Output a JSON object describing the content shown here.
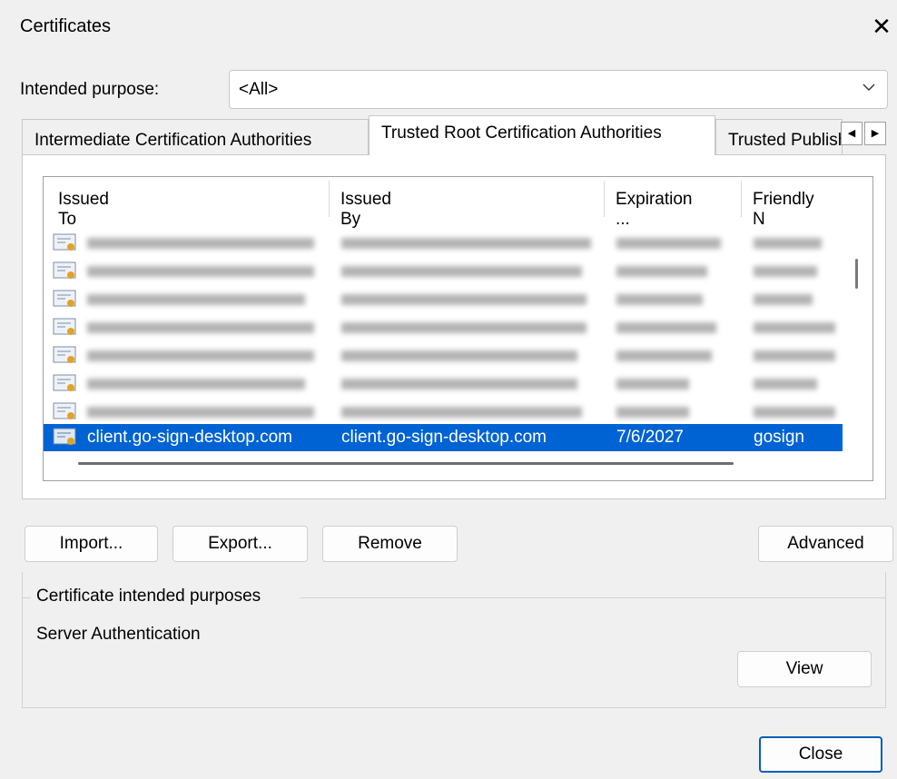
{
  "dialog": {
    "title": "Certificates",
    "close_glyph": "✕"
  },
  "intended_purpose": {
    "label": "Intended purpose:",
    "value": "<All>"
  },
  "tabs": [
    {
      "label": "Intermediate Certification Authorities",
      "active": false
    },
    {
      "label": "Trusted Root Certification Authorities",
      "active": true
    },
    {
      "label": "Trusted Publishers",
      "active": false
    }
  ],
  "tab_scroll": {
    "left": "◀",
    "right": "▶"
  },
  "list": {
    "columns": [
      "Issued To",
      "Issued By",
      "Expiration ...",
      "Friendly N"
    ],
    "blurred_row_count": 7,
    "selected_row": {
      "issued_to": "client.go-sign-desktop.com",
      "issued_by": "client.go-sign-desktop.com",
      "expiration": "7/6/2027",
      "friendly_name": "gosign"
    }
  },
  "buttons": {
    "import": "Import...",
    "export": "Export...",
    "remove": "Remove",
    "advanced": "Advanced",
    "view": "View",
    "close": "Close"
  },
  "purposes_group": {
    "legend": "Certificate intended purposes",
    "text": "Server Authentication"
  },
  "icons": [
    "certificate-icon",
    "chevron-down-icon",
    "close-icon",
    "arrow-left-icon",
    "arrow-right-icon"
  ],
  "colors": {
    "selection": "#0063d4",
    "default_button_border": "#005fb8"
  }
}
